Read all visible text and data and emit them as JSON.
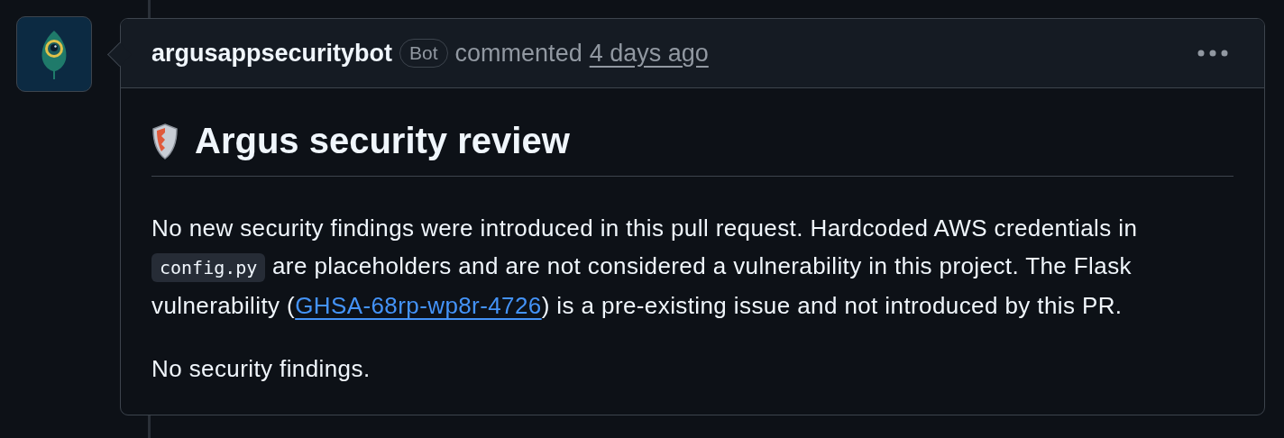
{
  "comment": {
    "author": "argusappsecuritybot",
    "badge": "Bot",
    "action": "commented",
    "time": "4 days ago",
    "heading": "Argus security review",
    "paragraphs": [
      [
        {
          "kind": "text",
          "text": "No new security findings were introduced in this pull request. Hardcoded AWS credentials in "
        },
        {
          "kind": "code",
          "text": "config.py"
        },
        {
          "kind": "text",
          "text": " are placeholders and are not considered a vulnerability in this project. The Flask vulnerability ("
        },
        {
          "kind": "link",
          "text": "GHSA-68rp-wp8r-4726"
        },
        {
          "kind": "text",
          "text": ") is a pre-existing issue and not introduced by this PR."
        }
      ],
      [
        {
          "kind": "text",
          "text": "No security findings."
        }
      ]
    ]
  }
}
